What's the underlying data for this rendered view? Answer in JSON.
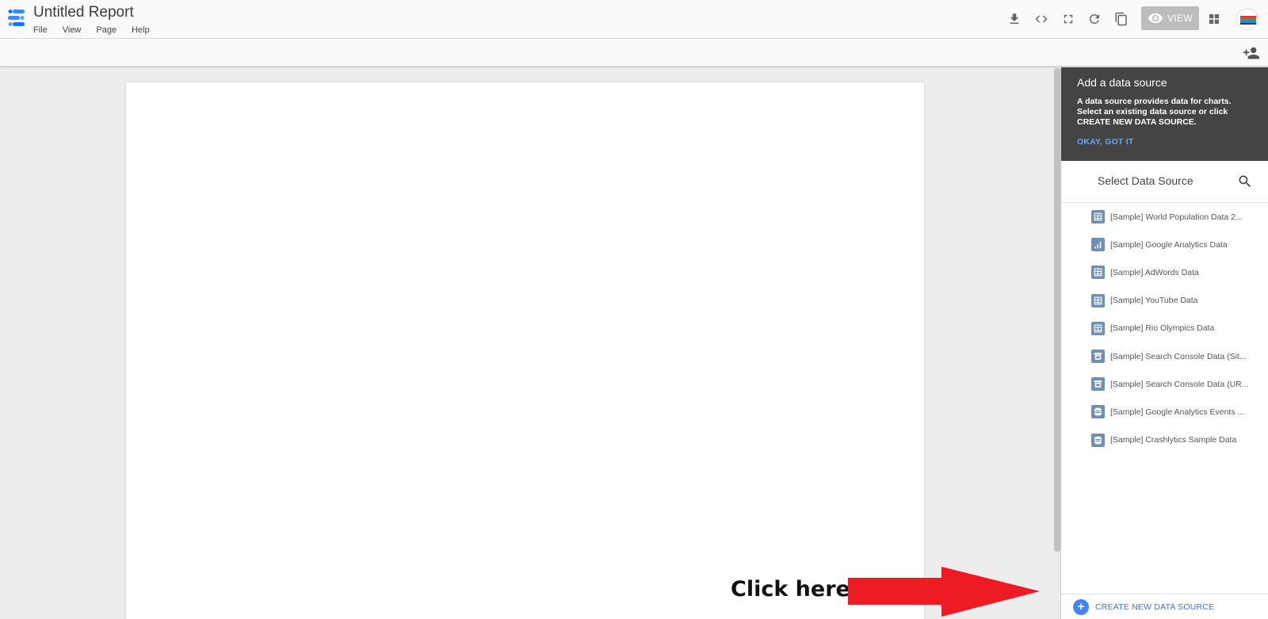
{
  "header": {
    "title": "Untitled Report",
    "menu": [
      "File",
      "View",
      "Page",
      "Help"
    ],
    "view_label": "VIEW",
    "icons": [
      "download-icon",
      "embed-code-icon",
      "fullscreen-icon",
      "refresh-icon",
      "copy-icon",
      "eye-icon",
      "apps-grid-icon"
    ]
  },
  "tip": {
    "title": "Add a data source",
    "body": "A data source provides data for charts. Select an existing data source or click CREATE NEW DATA SOURCE.",
    "ok": "OKAY, GOT IT"
  },
  "panel": {
    "select_label": "Select Data Source",
    "items": [
      {
        "label": "[Sample] World Population Data 2...",
        "icon": "table-icon"
      },
      {
        "label": "[Sample] Google Analytics Data",
        "icon": "bar-chart-icon"
      },
      {
        "label": "[Sample] AdWords Data",
        "icon": "table-icon"
      },
      {
        "label": "[Sample] YouTube Data",
        "icon": "table-icon"
      },
      {
        "label": "[Sample] Rio Olympics Data",
        "icon": "table-icon"
      },
      {
        "label": "[Sample] Search Console Data (Sit...",
        "icon": "search-console-icon"
      },
      {
        "label": "[Sample] Search Console Data (UR...",
        "icon": "search-console-icon"
      },
      {
        "label": "[Sample] Google Analytics Events ...",
        "icon": "database-icon"
      },
      {
        "label": "[Sample] Crashlytics Sample Data",
        "icon": "database-icon"
      }
    ],
    "create_label": "CREATE NEW DATA SOURCE"
  },
  "annotation": {
    "text": "Click here",
    "arrow_color": "#ed1c24"
  },
  "colors": {
    "accent": "#4285f4",
    "tip_link": "#5da9ff",
    "tip_bg": "#444444",
    "item_icon": "#6f8fb5"
  }
}
